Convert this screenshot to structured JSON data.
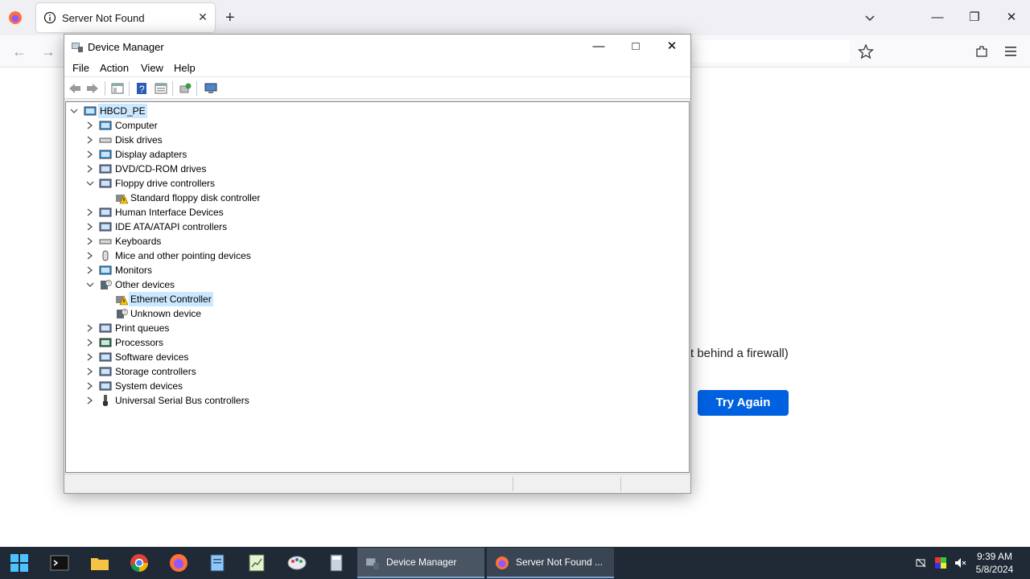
{
  "browser": {
    "tab_title": "Server Not Found",
    "firewall_text": "t behind a firewall)",
    "try_again_label": "Try Again"
  },
  "device_manager": {
    "title": "Device Manager",
    "menu": [
      "File",
      "Action",
      "View",
      "Help"
    ],
    "minimize": "—",
    "maximize": "□",
    "close": "✕",
    "tree": {
      "root": "HBCD_PE",
      "items": [
        {
          "label": "Computer",
          "expanded": false,
          "icon": "computer-icon"
        },
        {
          "label": "Disk drives",
          "expanded": false,
          "icon": "disk-icon"
        },
        {
          "label": "Display adapters",
          "expanded": false,
          "icon": "display-icon"
        },
        {
          "label": "DVD/CD-ROM drives",
          "expanded": false,
          "icon": "dvd-icon"
        },
        {
          "label": "Floppy drive controllers",
          "expanded": true,
          "icon": "floppy-controller-icon",
          "children": [
            {
              "label": "Standard floppy disk controller",
              "icon": "warning-device-icon"
            }
          ]
        },
        {
          "label": "Human Interface Devices",
          "expanded": false,
          "icon": "hid-icon"
        },
        {
          "label": "IDE ATA/ATAPI controllers",
          "expanded": false,
          "icon": "ide-icon"
        },
        {
          "label": "Keyboards",
          "expanded": false,
          "icon": "keyboard-icon"
        },
        {
          "label": "Mice and other pointing devices",
          "expanded": false,
          "icon": "mouse-icon"
        },
        {
          "label": "Monitors",
          "expanded": false,
          "icon": "monitor-icon"
        },
        {
          "label": "Other devices",
          "expanded": true,
          "icon": "unknown-device-icon",
          "children": [
            {
              "label": "Ethernet Controller",
              "icon": "warning-device-icon",
              "selected": true
            },
            {
              "label": "Unknown device",
              "icon": "unknown-device-icon"
            }
          ]
        },
        {
          "label": "Print queues",
          "expanded": false,
          "icon": "printer-icon"
        },
        {
          "label": "Processors",
          "expanded": false,
          "icon": "processor-icon"
        },
        {
          "label": "Software devices",
          "expanded": false,
          "icon": "software-icon"
        },
        {
          "label": "Storage controllers",
          "expanded": false,
          "icon": "storage-icon"
        },
        {
          "label": "System devices",
          "expanded": false,
          "icon": "system-icon"
        },
        {
          "label": "Universal Serial Bus controllers",
          "expanded": false,
          "icon": "usb-icon"
        }
      ]
    }
  },
  "taskbar": {
    "tasks": [
      {
        "label": "Device Manager",
        "icon": "device-manager-icon"
      },
      {
        "label": "Server Not Found ...",
        "icon": "firefox-icon"
      }
    ],
    "time": "9:39 AM",
    "date": "5/8/2024"
  }
}
